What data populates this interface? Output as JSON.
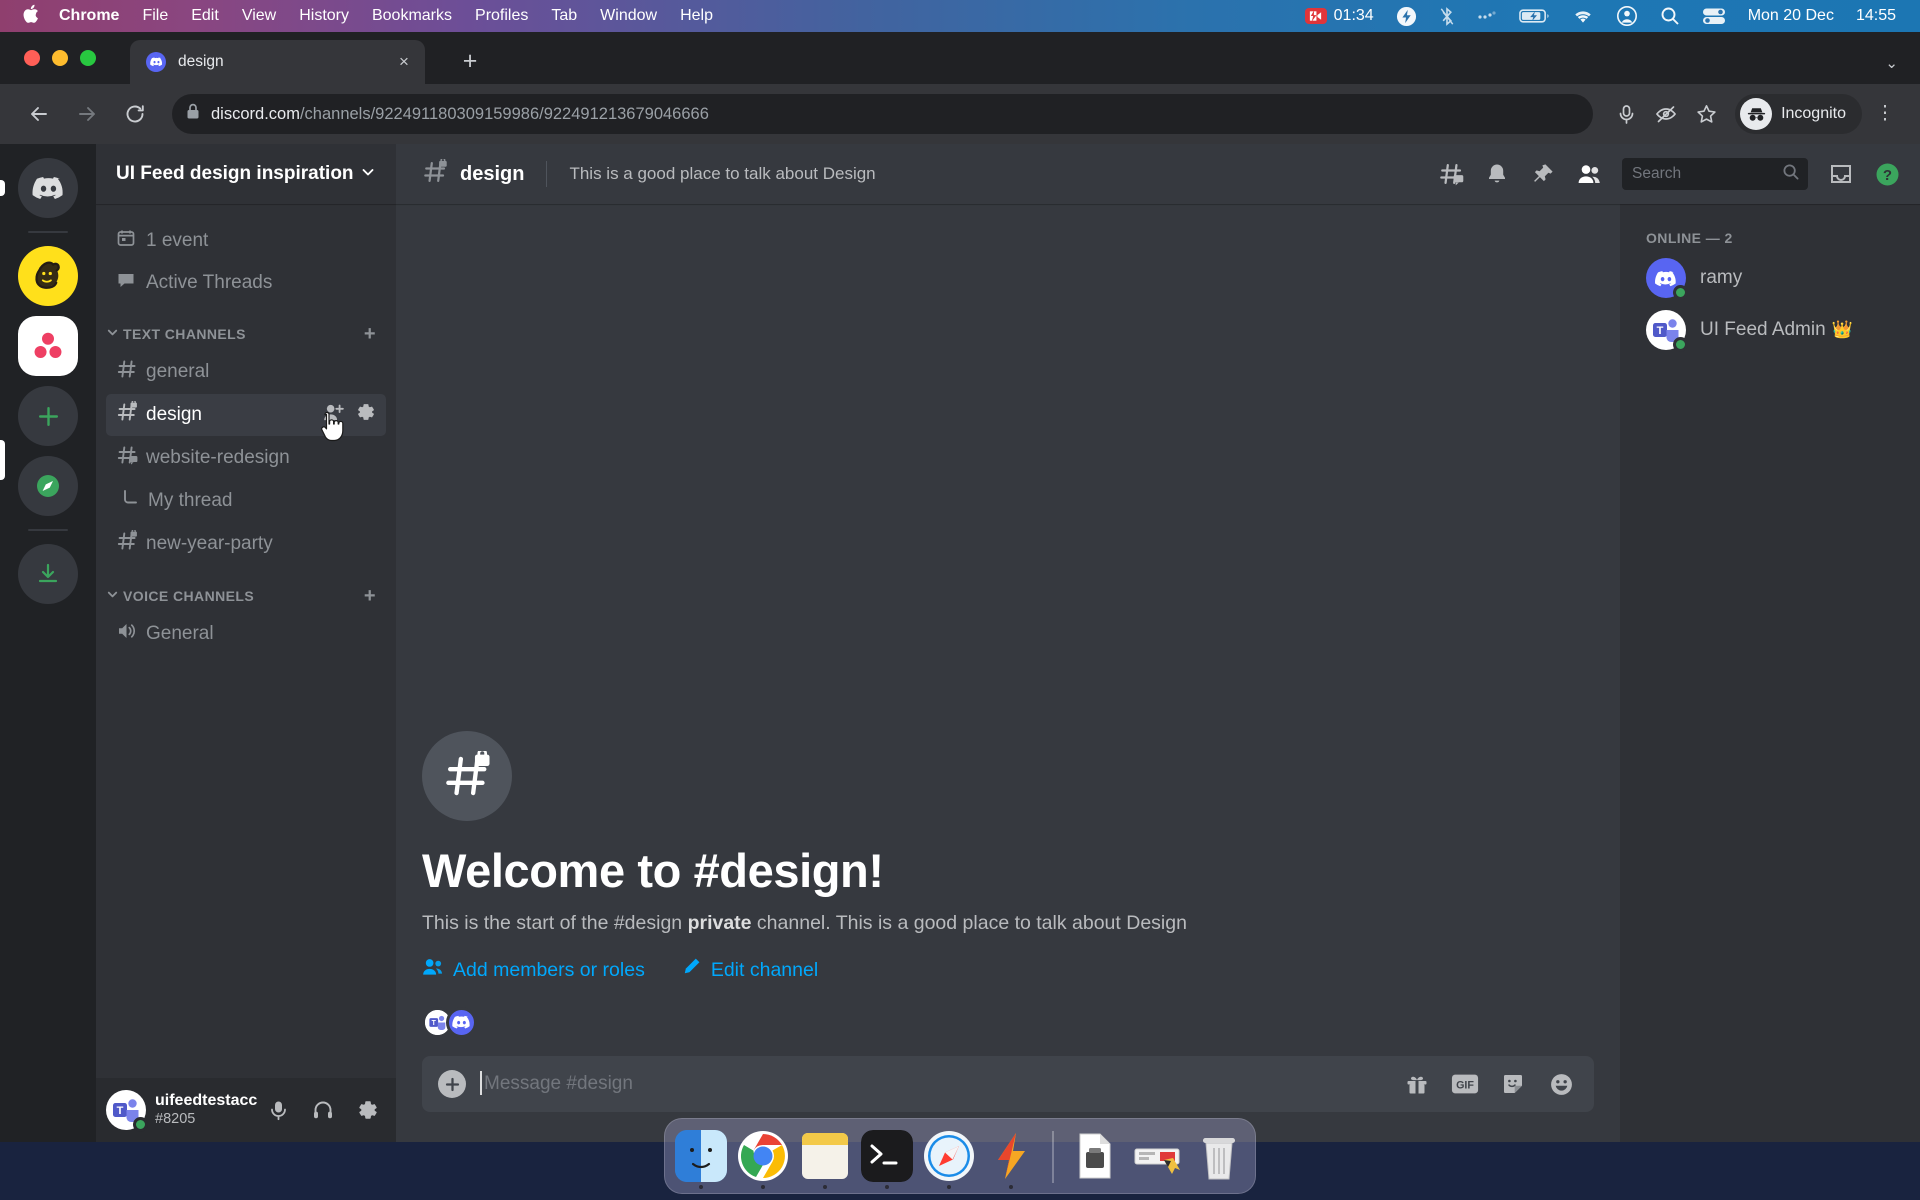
{
  "menubar": {
    "apple_icon": "apple-icon",
    "items": [
      {
        "label": "Chrome",
        "bold": true
      },
      {
        "label": "File",
        "bold": false
      },
      {
        "label": "Edit",
        "bold": false
      },
      {
        "label": "View",
        "bold": false
      },
      {
        "label": "History",
        "bold": false
      },
      {
        "label": "Bookmarks",
        "bold": false
      },
      {
        "label": "Profiles",
        "bold": false
      },
      {
        "label": "Tab",
        "bold": false
      },
      {
        "label": "Window",
        "bold": false
      },
      {
        "label": "Help",
        "bold": false
      }
    ],
    "screen_record_time": "01:34",
    "status_icons": [
      "flash-icon",
      "bluetooth-off-icon",
      "cellular-icon",
      "battery-charging-icon",
      "wifi-icon",
      "account-icon",
      "search-icon",
      "control-center-icon"
    ],
    "date": "Mon 20 Dec",
    "time": "14:55"
  },
  "browser": {
    "tab": {
      "title": "design",
      "favicon": "discord-icon",
      "close": "×"
    },
    "new_tab": "+",
    "tab_list_chevron": "⌄",
    "nav": {
      "back": "←",
      "forward": "→",
      "reload": "⟳"
    },
    "omnibox": {
      "lock_icon": "lock-icon",
      "domain": "discord.com",
      "path": "/channels/922491180309159986/922491213679046666"
    },
    "toolbar_icons": [
      "microphone-icon",
      "eye-off-icon",
      "bookmark-star-icon"
    ],
    "profile": {
      "label": "Incognito",
      "icon": "incognito-icon"
    },
    "menu": "⋮"
  },
  "discord": {
    "rail": [
      {
        "name": "home",
        "icon": "discord-home-icon",
        "active": false,
        "shape": "circle"
      },
      {
        "name": "mailchimp-server",
        "icon": "mailchimp-icon",
        "active": false,
        "shape": "circle"
      },
      {
        "name": "ui-feed-server",
        "icon": "ui-feed-icon",
        "active": true,
        "shape": "squircle"
      },
      {
        "name": "add-server",
        "icon": "plus-icon",
        "active": false,
        "shape": "circle"
      },
      {
        "name": "explore-servers",
        "icon": "compass-icon",
        "active": false,
        "shape": "circle"
      },
      {
        "name": "download-apps",
        "icon": "download-icon",
        "active": false,
        "shape": "circle"
      }
    ],
    "guild": {
      "name": "UI Feed design inspiration",
      "chevron": "⌄"
    },
    "nav_rows": [
      {
        "label": "1 event",
        "icon": "calendar-icon"
      },
      {
        "label": "Active Threads",
        "icon": "threads-icon"
      }
    ],
    "categories": [
      {
        "label": "TEXT CHANNELS",
        "add_label": "+",
        "channels": [
          {
            "label": "general",
            "icon": "hash-icon",
            "selected": false,
            "type": "text"
          },
          {
            "label": "design",
            "icon": "hash-lock-icon",
            "selected": true,
            "type": "text",
            "actions": [
              "add-member-icon",
              "settings-gear-icon"
            ]
          },
          {
            "label": "website-redesign",
            "icon": "hash-threads-icon",
            "selected": false,
            "type": "text"
          },
          {
            "label": "My thread",
            "icon": "thread-branch-icon",
            "selected": false,
            "type": "thread"
          },
          {
            "label": "new-year-party",
            "icon": "hash-lock-icon",
            "selected": false,
            "type": "text"
          }
        ]
      },
      {
        "label": "VOICE CHANNELS",
        "add_label": "+",
        "channels": [
          {
            "label": "General",
            "icon": "speaker-icon",
            "selected": false,
            "type": "voice"
          }
        ]
      }
    ],
    "user_panel": {
      "name": "uifeedtestacc",
      "tag": "#8205",
      "avatar": "teams-avatar",
      "status": "online",
      "icons": [
        "microphone-icon",
        "headphones-icon",
        "user-settings-gear-icon"
      ]
    },
    "channel_header": {
      "icon": "hash-lock-icon",
      "title": "design",
      "topic": "This is a good place to talk about Design",
      "icons": [
        "threads-icon",
        "notification-bell-icon",
        "pinned-messages-icon",
        "member-list-icon"
      ],
      "search_placeholder": "Search",
      "search_icon": "search-icon",
      "inbox_icon": "inbox-icon",
      "help_icon": "help-icon"
    },
    "welcome": {
      "icon": "hash-lock-icon",
      "title": "Welcome to #design!",
      "text_before": "This is the start of the #design ",
      "text_bold": "private",
      "text_after": " channel. This is a good place to talk about Design",
      "links": [
        {
          "label": "Add members or roles",
          "icon": "add-people-icon"
        },
        {
          "label": "Edit channel",
          "icon": "pencil-icon"
        }
      ],
      "facepile": [
        "teams-avatar",
        "discord-avatar"
      ]
    },
    "composer": {
      "add_icon": "plus-circle-icon",
      "placeholder": "Message #design",
      "icons": [
        "gift-icon",
        "gif-icon",
        "sticker-icon",
        "emoji-icon"
      ],
      "gif_label": "GIF"
    },
    "members": {
      "header": "ONLINE — 2",
      "list": [
        {
          "name": "ramy",
          "avatar": "discord-avatar",
          "status": "online",
          "badge": ""
        },
        {
          "name": "UI Feed Admin",
          "avatar": "teams-avatar",
          "status": "online",
          "badge": "👑"
        }
      ]
    }
  },
  "dock": {
    "items": [
      {
        "name": "finder",
        "running": true
      },
      {
        "name": "google-chrome",
        "running": true
      },
      {
        "name": "stickies",
        "running": true
      },
      {
        "name": "terminal",
        "running": true
      },
      {
        "name": "safari",
        "running": true
      },
      {
        "name": "flash-app",
        "running": true
      },
      {
        "name": "separator",
        "running": false
      },
      {
        "name": "document",
        "running": false
      },
      {
        "name": "sketch-file",
        "running": false
      },
      {
        "name": "trash",
        "running": false
      }
    ]
  },
  "colors": {
    "discord_blurple": "#5865f2",
    "discord_dark": "#36393f",
    "sidebar": "#2f3136",
    "rail": "#202225",
    "link_blue": "#00a8fc",
    "online_green": "#3ba55d"
  }
}
